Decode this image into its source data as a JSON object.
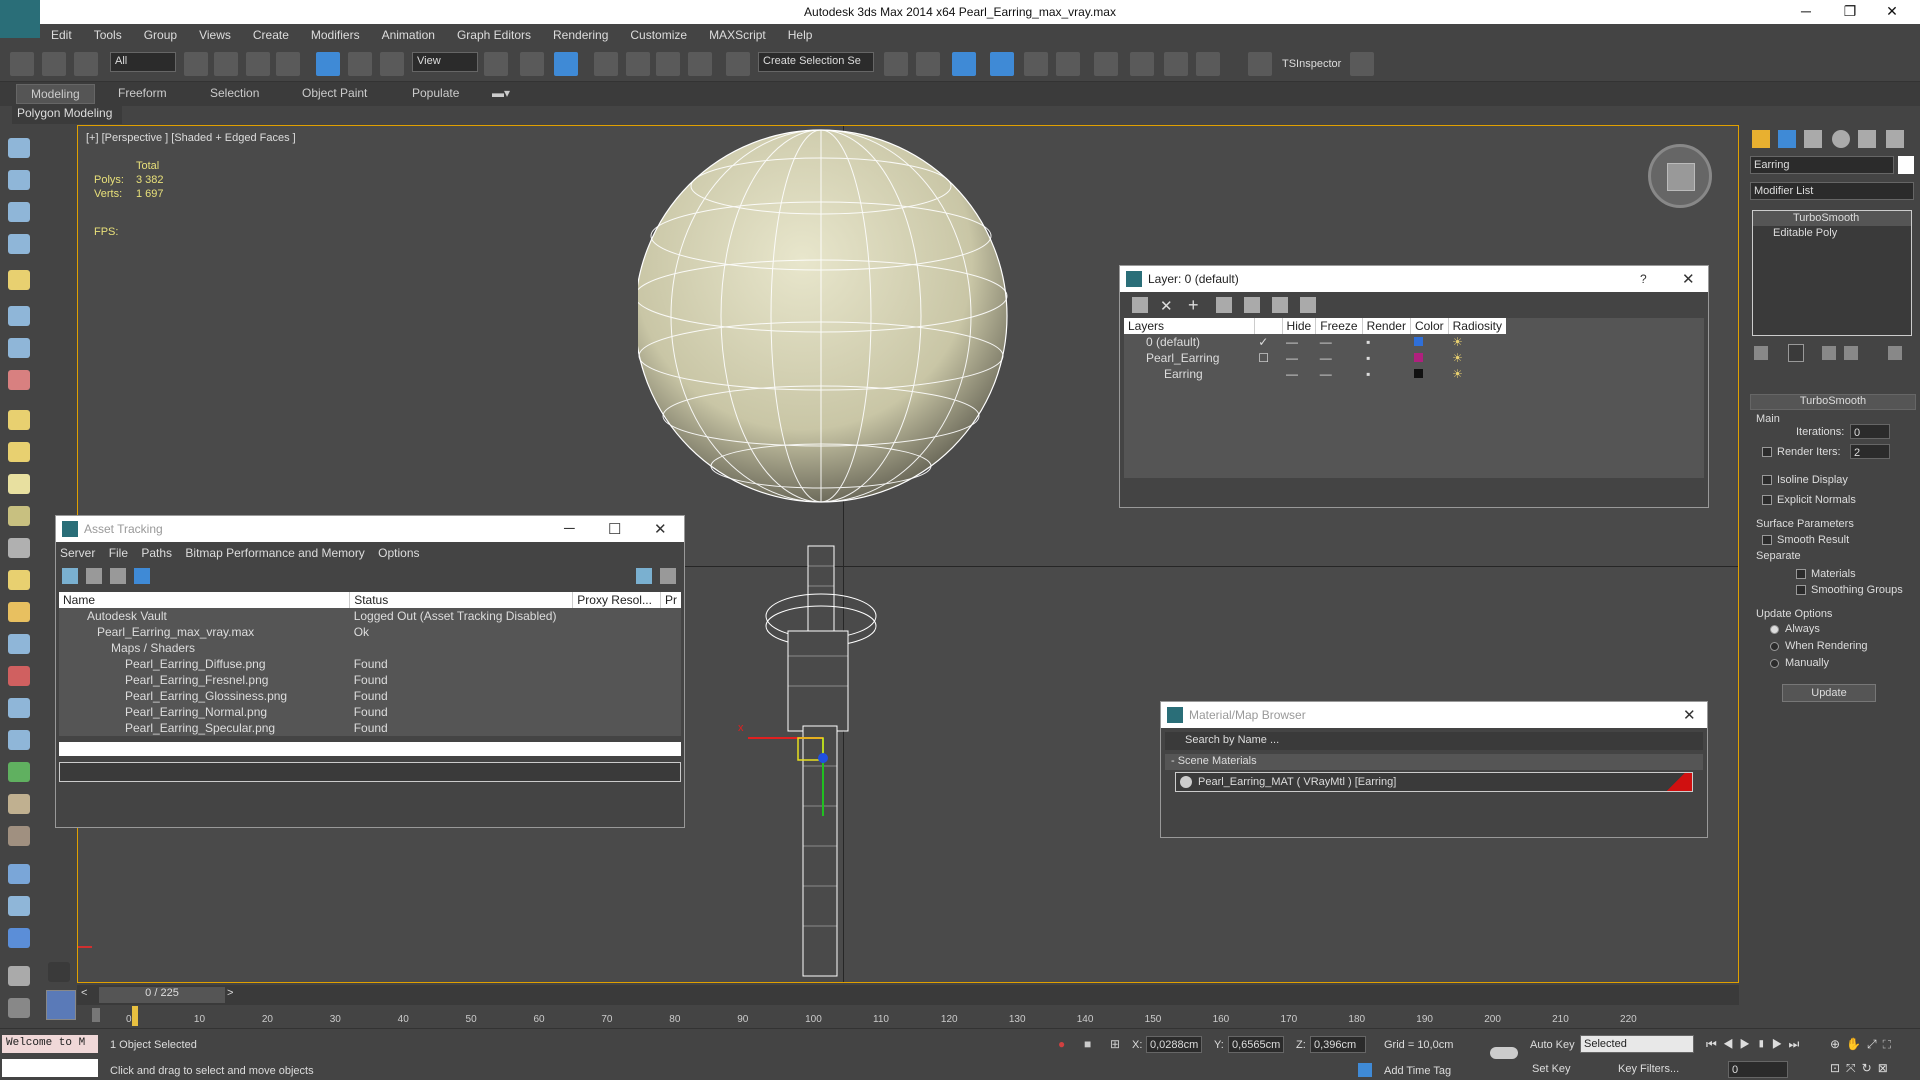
{
  "window": {
    "title": "Autodesk 3ds Max  2014 x64    Pearl_Earring_max_vray.max",
    "min": "─",
    "max": "❐",
    "close": "✕"
  },
  "menu": [
    "Edit",
    "Tools",
    "Group",
    "Views",
    "Create",
    "Modifiers",
    "Animation",
    "Graph Editors",
    "Rendering",
    "Customize",
    "MAXScript",
    "Help"
  ],
  "toolbar": {
    "filter": "All",
    "refcoord": "View",
    "selection_set": "Create Selection Se",
    "tsinspector": "TSInspector"
  },
  "ribbon": {
    "tabs": [
      "Modeling",
      "Freeform",
      "Selection",
      "Object Paint",
      "Populate"
    ],
    "panel": "Polygon Modeling"
  },
  "viewport": {
    "label": "[+] [Perspective ] [Shaded + Edged Faces ]",
    "stats_total": "Total",
    "polys_label": "Polys:",
    "polys": "3 382",
    "verts_label": "Verts:",
    "verts": "1 697",
    "fps_label": "FPS:",
    "axis_x": "x"
  },
  "asset_tracking": {
    "title": "Asset Tracking",
    "menu": [
      "Server",
      "File",
      "Paths",
      "Bitmap Performance and Memory",
      "Options"
    ],
    "columns": [
      "Name",
      "Status",
      "Proxy Resol...",
      "Pr"
    ],
    "rows": [
      {
        "name": "Autodesk Vault",
        "status": "Logged Out (Asset Tracking Disabled)"
      },
      {
        "name": "Pearl_Earring_max_vray.max",
        "status": "Ok"
      },
      {
        "name": "Maps / Shaders",
        "status": ""
      },
      {
        "name": "Pearl_Earring_Diffuse.png",
        "status": "Found"
      },
      {
        "name": "Pearl_Earring_Fresnel.png",
        "status": "Found"
      },
      {
        "name": "Pearl_Earring_Glossiness.png",
        "status": "Found"
      },
      {
        "name": "Pearl_Earring_Normal.png",
        "status": "Found"
      },
      {
        "name": "Pearl_Earring_Specular.png",
        "status": "Found"
      }
    ]
  },
  "layer_window": {
    "title": "Layer: 0 (default)",
    "help": "?",
    "columns": [
      "Layers",
      "",
      "Hide",
      "Freeze",
      "Render",
      "Color",
      "Radiosity"
    ],
    "rows": [
      {
        "name": "0 (default)",
        "color": "#2f6fd8"
      },
      {
        "name": "Pearl_Earring",
        "color": "#b0207e"
      },
      {
        "name": "Earring",
        "color": "#111111"
      }
    ]
  },
  "material_browser": {
    "title": "Material/Map Browser",
    "search_placeholder": "Search by Name ...",
    "group": "- Scene Materials",
    "item": "Pearl_Earring_MAT  ( VRayMtl )  [Earring]"
  },
  "command_panel": {
    "object_name": "Earring",
    "modifier_list": "Modifier List",
    "stack": [
      "TurboSmooth",
      "Editable Poly"
    ],
    "rollout": "TurboSmooth",
    "main": "Main",
    "iterations_label": "Iterations:",
    "iterations": "0",
    "render_iters_label": "Render Iters:",
    "render_iters": "2",
    "isoline": "Isoline Display",
    "explicit_normals": "Explicit Normals",
    "surface_params": "Surface Parameters",
    "smooth_result": "Smooth Result",
    "separate": "Separate",
    "materials": "Materials",
    "smoothing_groups": "Smoothing Groups",
    "update_options": "Update Options",
    "always": "Always",
    "when_rendering": "When Rendering",
    "manually": "Manually",
    "update_btn": "Update"
  },
  "timeline": {
    "frame": "0 / 225",
    "ticks": [
      "0",
      "10",
      "20",
      "30",
      "40",
      "50",
      "60",
      "70",
      "80",
      "90",
      "100",
      "110",
      "120",
      "130",
      "140",
      "150",
      "160",
      "170",
      "180",
      "190",
      "200",
      "210",
      "220"
    ]
  },
  "status": {
    "maxscript": "Welcome to M",
    "selected": "1 Object Selected",
    "prompt": "Click and drag to select and move objects",
    "x_label": "X:",
    "x": "0,0288cm",
    "y_label": "Y:",
    "y": "0,6565cm",
    "z_label": "Z:",
    "z": "0,396cm",
    "grid": "Grid = 10,0cm",
    "add_time_tag": "Add Time Tag",
    "auto_key": "Auto Key",
    "set_key": "Set Key",
    "key_mode": "Selected",
    "key_filters": "Key Filters...",
    "frame_field": "0"
  }
}
